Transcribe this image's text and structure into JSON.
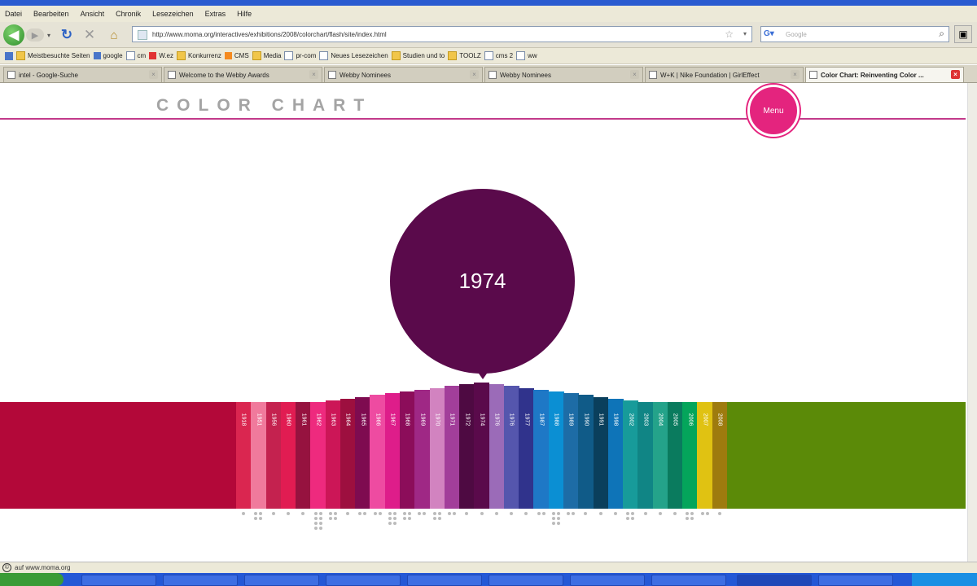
{
  "browser": {
    "menu": [
      "Datei",
      "Bearbeiten",
      "Ansicht",
      "Chronik",
      "Lesezeichen",
      "Extras",
      "Hilfe"
    ],
    "url": "http://www.moma.org/interactives/exhibitions/2008/colorchart/flash/site/index.html",
    "search_placeholder": "Google",
    "bookmarks": [
      {
        "label": "Meistbesuchte Seiten",
        "icon": "folder-icon"
      },
      {
        "label": "google",
        "icon": "google-icon"
      },
      {
        "label": "cm",
        "icon": "page-icon"
      },
      {
        "label": "W.ez",
        "icon": "w-icon"
      },
      {
        "label": "Konkurrenz",
        "icon": "folder-icon"
      },
      {
        "label": "CMS",
        "icon": "gear-icon"
      },
      {
        "label": "Media",
        "icon": "folder-icon"
      },
      {
        "label": "pr-com",
        "icon": "page-icon"
      },
      {
        "label": "Neues Lesezeichen",
        "icon": "page-icon"
      },
      {
        "label": "Studien und to",
        "icon": "folder-icon"
      },
      {
        "label": "TOOLZ",
        "icon": "folder-icon"
      },
      {
        "label": "cms 2",
        "icon": "page-icon"
      },
      {
        "label": "ww",
        "icon": "page-icon"
      }
    ],
    "tabs": [
      {
        "label": "intel - Google-Suche",
        "active": false
      },
      {
        "label": "Welcome to the Webby Awards",
        "active": false
      },
      {
        "label": "Webby Nominees",
        "active": false
      },
      {
        "label": "Webby Nominees",
        "active": false
      },
      {
        "label": "W+K | Nike Foundation | GirlEffect",
        "active": false
      },
      {
        "label": "Color Chart: Reinventing Color ...",
        "active": true
      }
    ],
    "status": "auf www.moma.org"
  },
  "page": {
    "title": "COLOR CHART",
    "menu_label": "Menu",
    "selected_year": "1974",
    "accent_color": "#e4247e",
    "rule_color": "#c33a8a",
    "bubble_color": "#5a0a4b",
    "band_left_color": "#b30839",
    "band_right_color": "#5b8a08"
  },
  "timeline": [
    {
      "year": "1918",
      "color": "#da2650",
      "dots": 1
    },
    {
      "year": "1951",
      "color": "#f07a9c",
      "dots": 4
    },
    {
      "year": "1956",
      "color": "#c4224f",
      "dots": 1
    },
    {
      "year": "1960",
      "color": "#e11c52",
      "dots": 1
    },
    {
      "year": "1961",
      "color": "#96123f",
      "dots": 1
    },
    {
      "year": "1962",
      "color": "#ee2a7e",
      "dots": 8
    },
    {
      "year": "1963",
      "color": "#cc1657",
      "dots": 4
    },
    {
      "year": "1964",
      "color": "#9d0f3f",
      "dots": 1
    },
    {
      "year": "1965",
      "color": "#7e0b50",
      "dots": 2
    },
    {
      "year": "1966",
      "color": "#ee4ba1",
      "dots": 2
    },
    {
      "year": "1967",
      "color": "#de1d8a",
      "dots": 6
    },
    {
      "year": "1968",
      "color": "#8c0d5a",
      "dots": 4
    },
    {
      "year": "1969",
      "color": "#9f2885",
      "dots": 2
    },
    {
      "year": "1970",
      "color": "#d283c0",
      "dots": 4
    },
    {
      "year": "1971",
      "color": "#a23e9a",
      "dots": 2
    },
    {
      "year": "1972",
      "color": "#4e0a42",
      "dots": 1
    },
    {
      "year": "1974",
      "color": "#5a0a4b",
      "dots": 1
    },
    {
      "year": "1976",
      "color": "#9b6bb8",
      "dots": 1
    },
    {
      "year": "1976",
      "color": "#5556ad",
      "dots": 1
    },
    {
      "year": "1977",
      "color": "#30338c",
      "dots": 1
    },
    {
      "year": "1987",
      "color": "#1e78c6",
      "dots": 2
    },
    {
      "year": "1988",
      "color": "#0b8fd3",
      "dots": 6
    },
    {
      "year": "1989",
      "color": "#1d6ca6",
      "dots": 2
    },
    {
      "year": "1990",
      "color": "#105b88",
      "dots": 1
    },
    {
      "year": "1991",
      "color": "#0a3f5c",
      "dots": 1
    },
    {
      "year": "1998",
      "color": "#0e74b8",
      "dots": 1
    },
    {
      "year": "2002",
      "color": "#179b9a",
      "dots": 4
    },
    {
      "year": "2003",
      "color": "#108585",
      "dots": 1
    },
    {
      "year": "2004",
      "color": "#24a38a",
      "dots": 1
    },
    {
      "year": "2005",
      "color": "#0a7b5e",
      "dots": 1
    },
    {
      "year": "2006",
      "color": "#04a55b",
      "dots": 4
    },
    {
      "year": "2007",
      "color": "#e0c212",
      "dots": 2
    },
    {
      "year": "2008",
      "color": "#9e7b0e",
      "dots": 1
    }
  ]
}
